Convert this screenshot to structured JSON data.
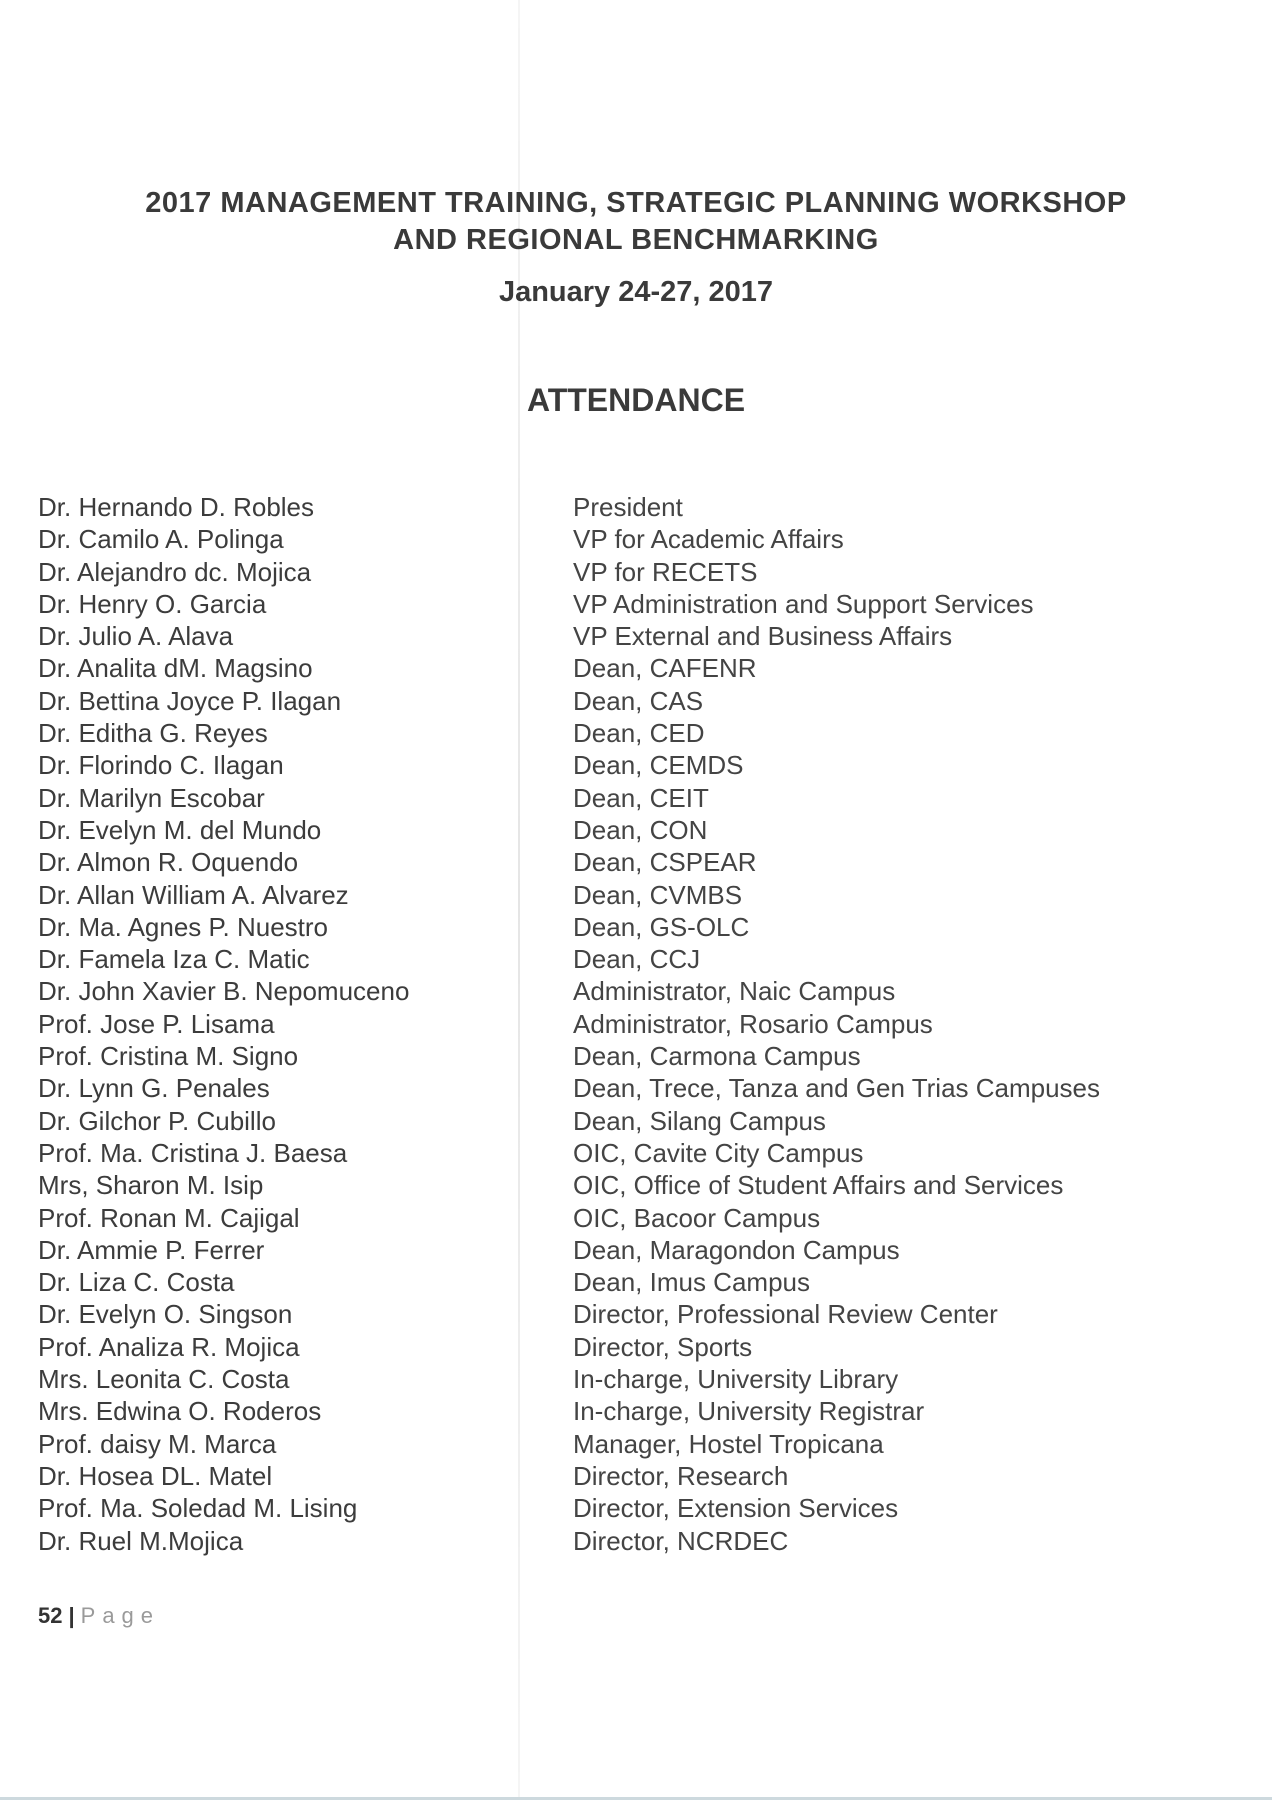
{
  "document": {
    "title_line_1": "2017 MANAGEMENT TRAINING, STRATEGIC PLANNING WORKSHOP",
    "title_line_2": "AND REGIONAL BENCHMARKING",
    "date": "January 24-27, 2017",
    "section_heading": "ATTENDANCE"
  },
  "attendance": [
    {
      "name": "Dr. Hernando D. Robles",
      "position": "President"
    },
    {
      "name": "Dr. Camilo A. Polinga",
      "position": "VP for Academic Affairs"
    },
    {
      "name": "Dr. Alejandro dc. Mojica",
      "position": "VP for RECETS"
    },
    {
      "name": "Dr. Henry O. Garcia",
      "position": "VP Administration and Support Services"
    },
    {
      "name": "Dr. Julio A. Alava",
      "position": "VP External and Business Affairs"
    },
    {
      "name": "Dr. Analita dM. Magsino",
      "position": "Dean, CAFENR"
    },
    {
      "name": "Dr. Bettina Joyce P. Ilagan",
      "position": "Dean, CAS"
    },
    {
      "name": "Dr. Editha G. Reyes",
      "position": "Dean, CED"
    },
    {
      "name": "Dr. Florindo C. Ilagan",
      "position": "Dean, CEMDS"
    },
    {
      "name": "Dr. Marilyn Escobar",
      "position": "Dean, CEIT"
    },
    {
      "name": "Dr. Evelyn M. del Mundo",
      "position": "Dean, CON"
    },
    {
      "name": "Dr. Almon R. Oquendo",
      "position": "Dean, CSPEAR"
    },
    {
      "name": "Dr. Allan William A. Alvarez",
      "position": "Dean, CVMBS"
    },
    {
      "name": "Dr. Ma. Agnes P. Nuestro",
      "position": "Dean, GS-OLC"
    },
    {
      "name": "Dr. Famela Iza C. Matic",
      "position": "Dean, CCJ"
    },
    {
      "name": "Dr. John Xavier B. Nepomuceno",
      "position": "Administrator, Naic Campus"
    },
    {
      "name": "Prof. Jose P. Lisama",
      "position": "Administrator, Rosario Campus"
    },
    {
      "name": "Prof. Cristina M. Signo",
      "position": "Dean, Carmona Campus"
    },
    {
      "name": "Dr. Lynn G. Penales",
      "position": "Dean, Trece, Tanza and Gen Trias Campuses"
    },
    {
      "name": "Dr. Gilchor P. Cubillo",
      "position": "Dean, Silang Campus"
    },
    {
      "name": "Prof. Ma. Cristina J. Baesa",
      "position": "OIC, Cavite City Campus"
    },
    {
      "name": "Mrs, Sharon M. Isip",
      "position": "OIC, Office of Student Affairs and Services"
    },
    {
      "name": "Prof. Ronan M. Cajigal",
      "position": "OIC, Bacoor Campus"
    },
    {
      "name": "Dr. Ammie P. Ferrer",
      "position": "Dean, Maragondon Campus"
    },
    {
      "name": "Dr. Liza C. Costa",
      "position": "Dean, Imus Campus"
    },
    {
      "name": "Dr. Evelyn O. Singson",
      "position": "Director, Professional Review Center"
    },
    {
      "name": "Prof. Analiza R. Mojica",
      "position": "Director, Sports"
    },
    {
      "name": "Mrs. Leonita C. Costa",
      "position": "In-charge, University Library"
    },
    {
      "name": "Mrs. Edwina O. Roderos",
      "position": "In-charge, University Registrar"
    },
    {
      "name": "Prof. daisy M. Marca",
      "position": "Manager, Hostel Tropicana"
    },
    {
      "name": "Dr. Hosea DL. Matel",
      "position": "Director, Research"
    },
    {
      "name": "Prof. Ma. Soledad M. Lising",
      "position": "Director, Extension Services"
    },
    {
      "name": "Dr. Ruel M.Mojica",
      "position": "Director, NCRDEC"
    }
  ],
  "footer": {
    "page_number": "52",
    "separator": "|",
    "page_label": "Page"
  }
}
